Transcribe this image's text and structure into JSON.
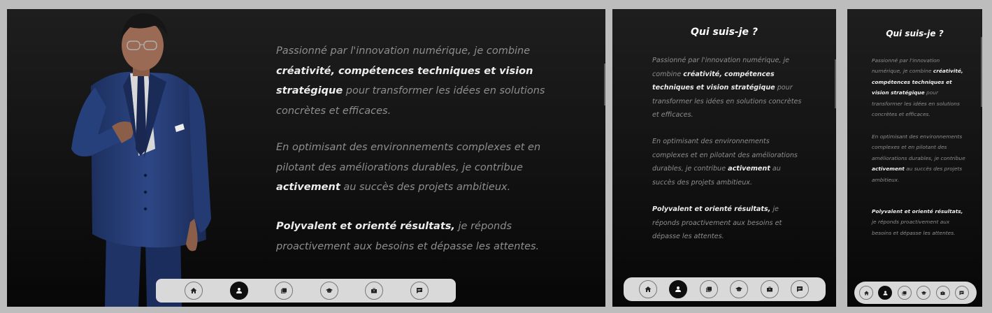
{
  "tablet": {
    "title": "Qui suis-je ?"
  },
  "mobile": {
    "title": "Qui suis-je ?"
  },
  "about": {
    "p1": {
      "a": "Passionné par l'innovation numérique, je combine ",
      "b": "créativité, compétences techniques et vision stratégique",
      "c": " pour transformer les idées en solutions concrètes et efficaces."
    },
    "p2": {
      "a": "En optimisant des environnements complexes et en pilotant des améliorations durables, je contribue ",
      "b": "activement",
      "c": " au succès des projets ambitieux."
    },
    "p3": {
      "a": "",
      "b": "Polyvalent et orienté résultats,",
      "c": " je réponds proactivement aux besoins et dépasse les attentes."
    }
  },
  "nav": {
    "items": [
      {
        "icon": "home-icon",
        "active": false
      },
      {
        "icon": "user-icon",
        "active": true
      },
      {
        "icon": "portfolio-icon",
        "active": false
      },
      {
        "icon": "graduation-cap-icon",
        "active": false
      },
      {
        "icon": "briefcase-icon",
        "active": false
      },
      {
        "icon": "chat-icon",
        "active": false
      }
    ]
  },
  "colors": {
    "page_bg": "#bdbdbd",
    "panel_bg": "#141414",
    "nav_bg": "#d9d9d9",
    "active_btn": "#0e0e0e",
    "text_muted": "#8e8e8e",
    "text_bold": "#ededed"
  }
}
